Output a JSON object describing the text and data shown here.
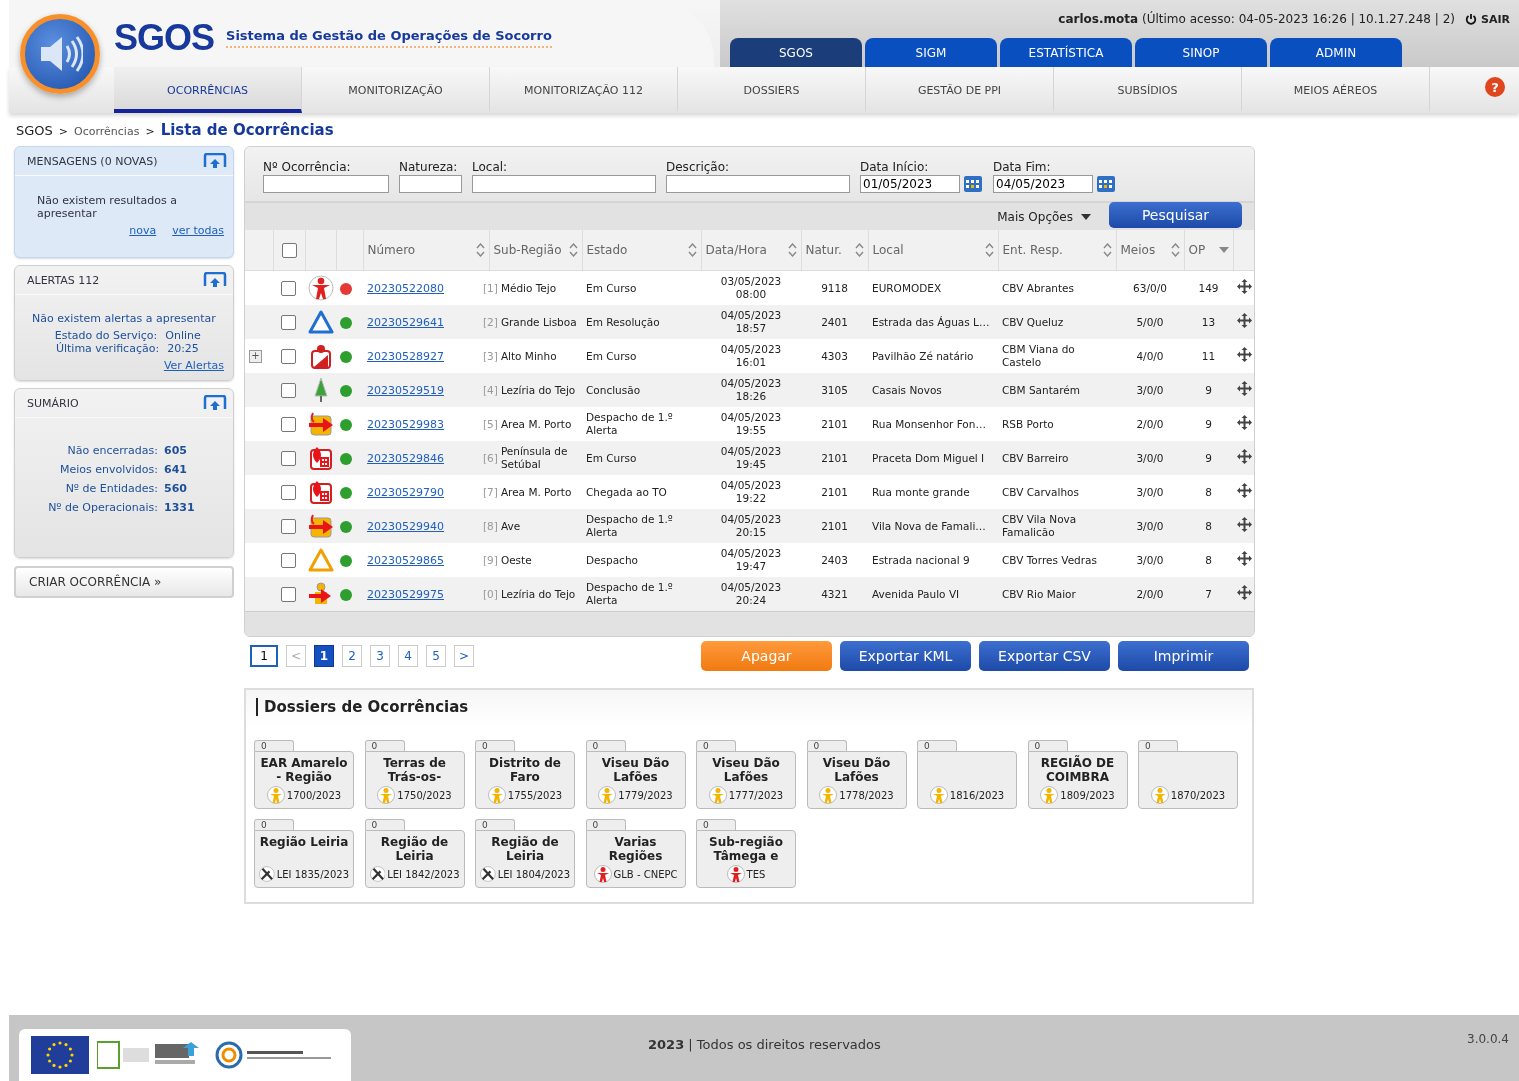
{
  "header": {
    "logo_text": "SGOS",
    "subtitle": "Sistema de Gestão de Operações de Socorro",
    "user": "carlos.mota",
    "access": "(Último acesso: 04-05-2023 16:26 | 10.1.27.248 | 2)",
    "logout": "SAIR",
    "help": "?"
  },
  "top_tabs": [
    {
      "label": "SGOS",
      "selected": true
    },
    {
      "label": "SIGM",
      "selected": false
    },
    {
      "label": "ESTATÍSTICA",
      "selected": false
    },
    {
      "label": "SINOP",
      "selected": false
    },
    {
      "label": "ADMIN",
      "selected": false
    }
  ],
  "nav": [
    {
      "label": "OCORRÊNCIAS",
      "selected": true
    },
    {
      "label": "MONITORIZAÇÃO",
      "selected": false
    },
    {
      "label": "MONITORIZAÇÃO 112",
      "selected": false
    },
    {
      "label": "DOSSIERS",
      "selected": false
    },
    {
      "label": "GESTÃO DE PPI",
      "selected": false
    },
    {
      "label": "SUBSÍDIOS",
      "selected": false
    },
    {
      "label": "MEIOS AÉREOS",
      "selected": false
    }
  ],
  "breadcrumb": {
    "items": [
      "SGOS",
      "Ocorrências"
    ],
    "separator": ">",
    "current": "Lista de Ocorrências"
  },
  "sidebar": {
    "messages": {
      "title": "MENSAGENS (0 NOVAS)",
      "text": "Não existem resultados a apresentar",
      "links": [
        "nova",
        "ver todas"
      ]
    },
    "alerts": {
      "title": "ALERTAS 112",
      "text": "Não existem alertas a apresentar",
      "stats": [
        {
          "label": "Estado do Serviço:",
          "value": "Online"
        },
        {
          "label": "Última verificação:",
          "value": "20:25"
        }
      ],
      "link": "Ver Alertas"
    },
    "summary": {
      "title": "SUMÁRIO",
      "stats": [
        {
          "label": "Não encerradas:",
          "value": "605"
        },
        {
          "label": "Meios envolvidos:",
          "value": "641"
        },
        {
          "label": "Nº de Entidades:",
          "value": "560"
        },
        {
          "label": "Nº de Operacionais:",
          "value": "1331"
        }
      ]
    },
    "create_button": "CRIAR OCORRÊNCIA »"
  },
  "filters": [
    {
      "label": "Nº Ocorrência:",
      "kind": "text"
    },
    {
      "label": "Natureza:",
      "kind": "text"
    },
    {
      "label": "Local:",
      "kind": "text"
    },
    {
      "label": "Descrição:",
      "kind": "text"
    },
    {
      "label": "Data Início:",
      "kind": "date",
      "value": "01/05/2023"
    },
    {
      "label": "Data Fim:",
      "kind": "date",
      "value": "04/05/2023"
    }
  ],
  "more_options": "Mais Opções",
  "search_button": "Pesquisar",
  "table": {
    "select_all_checked": false,
    "columns": [
      {
        "label": "Número",
        "kind": "sortable"
      },
      {
        "label": "Sub-Região",
        "kind": "sortable"
      },
      {
        "label": "Estado",
        "kind": "sortable"
      },
      {
        "label": "Data/Hora",
        "kind": "sortable"
      },
      {
        "label": "Natur.",
        "kind": "sortable"
      },
      {
        "label": "Local",
        "kind": "sortable"
      },
      {
        "label": "Ent. Resp.",
        "kind": "sortable"
      },
      {
        "label": "Meios",
        "kind": "sortable"
      },
      {
        "label": "OP",
        "kind": "sorted"
      }
    ],
    "rows": [
      {
        "checked": false,
        "kind": "person",
        "color": "#e53935",
        "number": "20230522080",
        "index": "[1]",
        "region": "Médio Tejo",
        "state": "Em Curso",
        "date": "03/05/2023",
        "time": "08:00",
        "nature": "9118",
        "local": "EUROMODEX",
        "entity": "CBV Abrantes",
        "meios": "63/0/0",
        "op": "149"
      },
      {
        "checked": false,
        "kind": "warning",
        "color": "#2e9e2e",
        "number": "20230529641",
        "index": "[2]",
        "region": "Grande Lisboa",
        "state": "Em Resolução",
        "date": "04/05/2023",
        "time": "18:57",
        "nature": "2401",
        "local": "Estrada das Águas L…",
        "entity": "CBV Queluz",
        "meios": "5/0/0",
        "op": "13"
      },
      {
        "expand": "+",
        "checked": false,
        "kind": "injury",
        "color": "#2e9e2e",
        "number": "20230528927",
        "index": "[3]",
        "region": "Alto Minho",
        "state": "Em Curso",
        "date": "04/05/2023",
        "time": "16:01",
        "nature": "4303",
        "local": "Pavilhão Zé natário",
        "entity": "CBM Viana do Castelo",
        "meios": "4/0/0",
        "op": "11"
      },
      {
        "checked": false,
        "kind": "forest",
        "color": "#2e9e2e",
        "number": "20230529519",
        "index": "[4]",
        "region": "Lezíria do Tejo",
        "state": "Conclusão",
        "date": "04/05/2023",
        "time": "18:26",
        "nature": "3105",
        "local": "Casais Novos",
        "entity": "CBM Santarém",
        "meios": "3/0/0",
        "op": "9"
      },
      {
        "checked": false,
        "kind": "dispatch",
        "color": "#2e9e2e",
        "number": "20230529983",
        "index": "[5]",
        "region": "Area M. Porto",
        "state": "Despacho de 1.º Alerta",
        "date": "04/05/2023",
        "time": "19:55",
        "nature": "2101",
        "local": "Rua Monsenhor Fon…",
        "entity": "RSB Porto",
        "meios": "2/0/0",
        "op": "9"
      },
      {
        "checked": false,
        "kind": "fire",
        "color": "#2e9e2e",
        "number": "20230529846",
        "index": "[6]",
        "region": "Península de Setúbal",
        "state": "Em Curso",
        "date": "04/05/2023",
        "time": "19:45",
        "nature": "2101",
        "local": "Praceta Dom Miguel I",
        "entity": "CBV Barreiro",
        "meios": "3/0/0",
        "op": "9"
      },
      {
        "checked": false,
        "kind": "fire",
        "color": "#2e9e2e",
        "number": "20230529790",
        "index": "[7]",
        "region": "Area M. Porto",
        "state": "Chegada ao TO",
        "date": "04/05/2023",
        "time": "19:22",
        "nature": "2101",
        "local": "Rua monte grande",
        "entity": "CBV Carvalhos",
        "meios": "3/0/0",
        "op": "8"
      },
      {
        "checked": false,
        "kind": "dispatch",
        "color": "#2e9e2e",
        "number": "20230529940",
        "index": "[8]",
        "region": "Ave",
        "state": "Despacho de 1.º Alerta",
        "date": "04/05/2023",
        "time": "20:15",
        "nature": "2101",
        "local": "Vila Nova de Famali…",
        "entity": "CBV Vila Nova Famalicão",
        "meios": "3/0/0",
        "op": "8"
      },
      {
        "checked": false,
        "kind": "hazard",
        "color": "#2e9e2e",
        "number": "20230529865",
        "index": "[9]",
        "region": "Oeste",
        "state": "Despacho",
        "date": "04/05/2023",
        "time": "19:47",
        "nature": "2403",
        "local": "Estrada nacional 9",
        "entity": "CBV Torres Vedras",
        "meios": "3/0/0",
        "op": "8"
      },
      {
        "checked": false,
        "kind": "rescue",
        "color": "#2e9e2e",
        "number": "20230529975",
        "index": "[0]",
        "region": "Lezíria do Tejo",
        "state": "Despacho de 1.º Alerta",
        "date": "04/05/2023",
        "time": "20:24",
        "nature": "4321",
        "local": "Avenida Paulo VI",
        "entity": "CBV Rio Maior",
        "meios": "2/0/0",
        "op": "7"
      }
    ]
  },
  "pagination": {
    "page_input": "1",
    "prev": "<",
    "next": ">",
    "pages": [
      {
        "label": "1",
        "selected": true
      },
      {
        "label": "2",
        "selected": false
      },
      {
        "label": "3",
        "selected": false
      },
      {
        "label": "4",
        "selected": false
      },
      {
        "label": "5",
        "selected": false
      }
    ]
  },
  "actions": [
    {
      "label": "Apagar",
      "kind": "danger"
    },
    {
      "label": "Exportar KML",
      "kind": "primary"
    },
    {
      "label": "Exportar CSV",
      "kind": "primary"
    },
    {
      "label": "Imprimir",
      "kind": "primary"
    }
  ],
  "dossiers": {
    "title": "Dossiers de Ocorrências",
    "folders": [
      {
        "count": "0",
        "title": "EAR Amarelo - Região",
        "kind": "district",
        "code": "1700/2023"
      },
      {
        "count": "0",
        "title": "Terras de Trás-os-",
        "kind": "district",
        "code": "1750/2023"
      },
      {
        "count": "0",
        "title": "Distrito de Faro",
        "kind": "district",
        "code": "1755/2023"
      },
      {
        "count": "0",
        "title": "Viseu Dão Lafões",
        "kind": "district",
        "code": "1779/2023"
      },
      {
        "count": "0",
        "title": "Viseu Dão Lafões",
        "kind": "district",
        "code": "1777/2023"
      },
      {
        "count": "0",
        "title": "Viseu Dão Lafões",
        "kind": "district",
        "code": "1778/2023"
      },
      {
        "count": "0",
        "kind": "district",
        "code": "1816/2023"
      },
      {
        "count": "0",
        "title": "REGIÃO DE COIMBRA",
        "kind": "district",
        "code": "1809/2023"
      },
      {
        "count": "0",
        "kind": "district",
        "code": "1870/2023"
      },
      {
        "count": "0",
        "title": "Região Leiria",
        "kind": "technical",
        "code": "LEI 1835/2023"
      },
      {
        "count": "0",
        "title": "Região de Leiria",
        "kind": "technical",
        "code": "LEI 1842/2023"
      },
      {
        "count": "0",
        "title": "Região de Leiria",
        "kind": "technical",
        "code": "LEI 1804/2023"
      },
      {
        "count": "0",
        "title": "Varias Regiões",
        "kind": "national",
        "code": "GLB - CNEPC"
      },
      {
        "count": "0",
        "title": "Sub-região Tâmega e",
        "kind": "national",
        "code": "TES"
      }
    ]
  },
  "footer": {
    "year": "2023",
    "text": "| Todos os direitos reservados",
    "version": "3.0.0.4"
  }
}
